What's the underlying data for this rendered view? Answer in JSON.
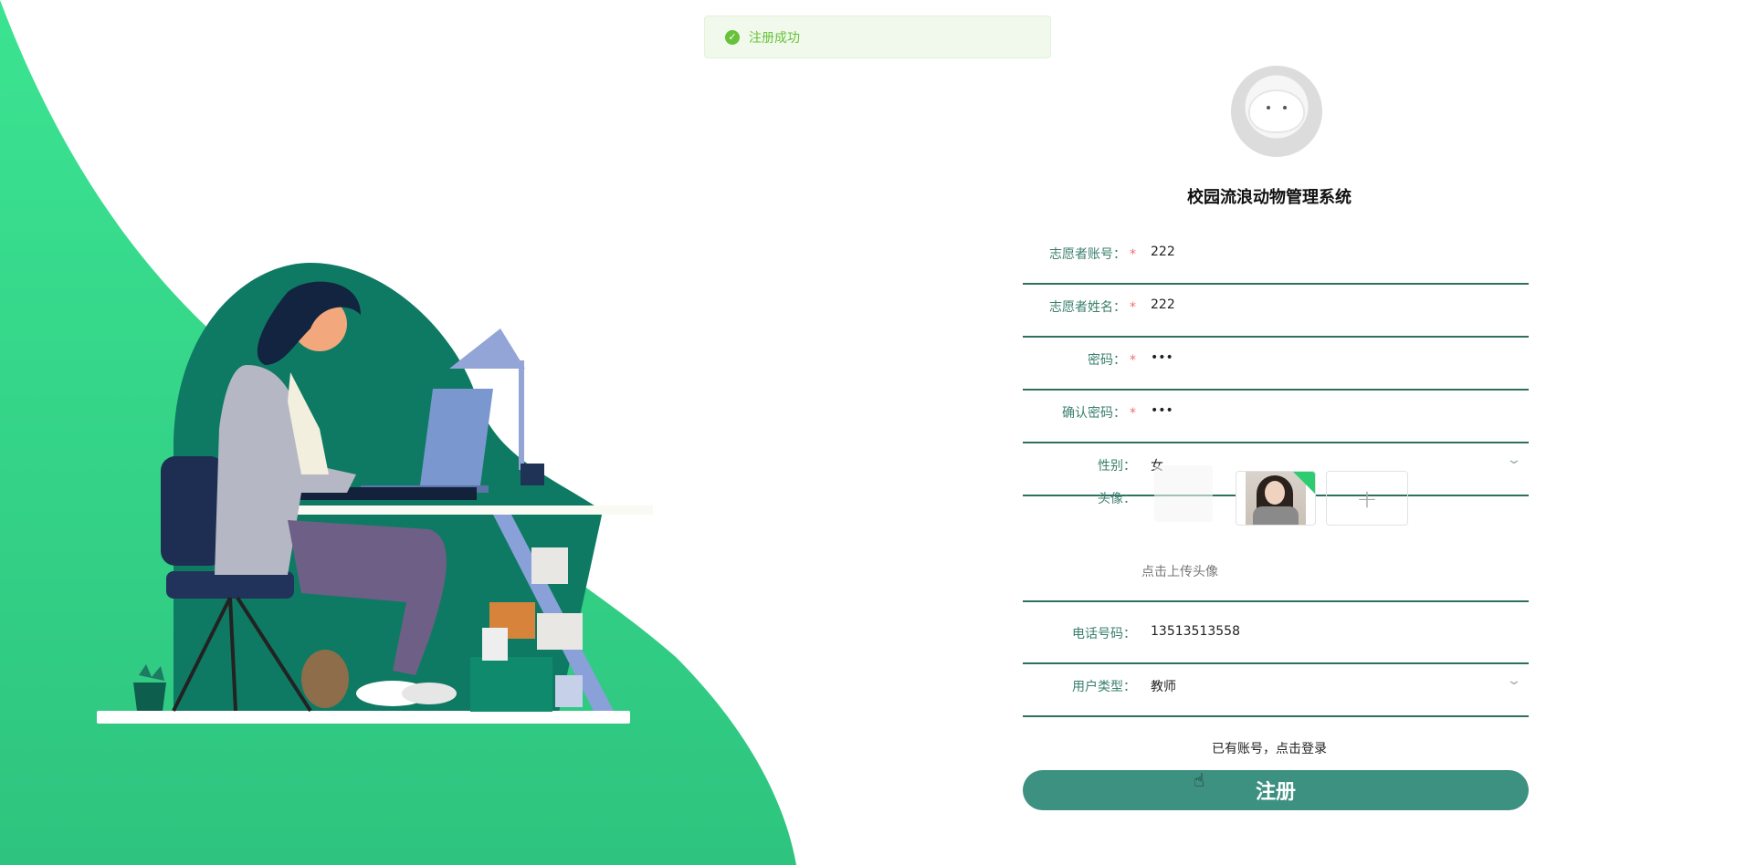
{
  "toast": {
    "message": "注册成功"
  },
  "app": {
    "title": "校园流浪动物管理系统"
  },
  "form": {
    "fields": [
      {
        "label": "志愿者账号",
        "value": "222",
        "required": true
      },
      {
        "label": "志愿者姓名",
        "value": "222",
        "required": true
      },
      {
        "label": "密码",
        "value": "•••",
        "required": true
      },
      {
        "label": "确认密码",
        "value": "•••",
        "required": true
      },
      {
        "label": "性别",
        "value": "女",
        "required": false
      },
      {
        "label": "电话号码",
        "value": "13513513558",
        "required": false
      },
      {
        "label": "用户类型",
        "value": "教师",
        "required": false
      }
    ],
    "avatar": {
      "label": "头像",
      "hint": "点击上传头像",
      "add_icon": "+"
    },
    "suffix": "：",
    "required_mark": "*"
  },
  "actions": {
    "login_link": "已有账号，点击登录",
    "submit": "注册"
  },
  "colors": {
    "brand": "#3d9180",
    "field_border": "#2e6f5f",
    "bg_green": "#33c985"
  }
}
